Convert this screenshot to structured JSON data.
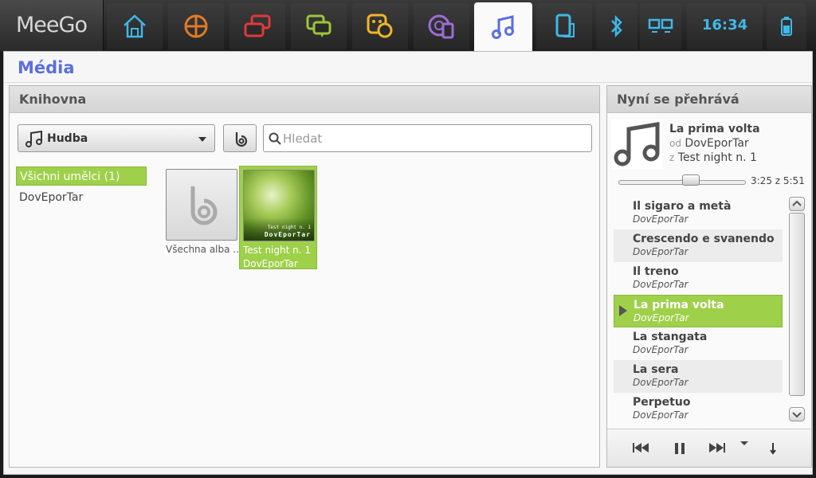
{
  "topbar": {
    "logo": "MeeGo",
    "tabs": [
      {
        "name": "home",
        "icon": "home-icon"
      },
      {
        "name": "apps",
        "icon": "apps-icon"
      },
      {
        "name": "zones",
        "icon": "zones-icon"
      },
      {
        "name": "status",
        "icon": "chat-icon"
      },
      {
        "name": "people",
        "icon": "people-icon"
      },
      {
        "name": "internet",
        "icon": "web-icon"
      },
      {
        "name": "media",
        "icon": "music-icon",
        "active": true
      },
      {
        "name": "devices",
        "icon": "devices-icon"
      }
    ],
    "clock": "16:34",
    "accent": "#3fb8e8"
  },
  "window": {
    "title": "Média"
  },
  "library": {
    "header": "Knihovna",
    "dropdown_value": "Hudba",
    "search_placeholder": "Hledat",
    "artists": [
      {
        "label": "Všichni umělci (1)",
        "selected": true
      },
      {
        "label": "DovEporTar",
        "selected": false
      }
    ],
    "albums": [
      {
        "title": "Všechna alba ...",
        "artist": "",
        "selected": false
      },
      {
        "title": "Test night n. 1",
        "artist": "DovEporTar",
        "selected": true,
        "cover_text_1": "Test night n. 1",
        "cover_text_2": "DovEporTar"
      }
    ]
  },
  "now_playing": {
    "header": "Nyní se přehrává",
    "title": "La prima volta",
    "by_label": "od",
    "artist": "DovEporTar",
    "from_label": "z",
    "album": "Test night n. 1",
    "time": "3:25 z 5:51",
    "progress": 0.58,
    "songs": [
      {
        "title": "Il sigaro a metà",
        "artist": "DovEporTar"
      },
      {
        "title": "Crescendo e svanendo",
        "artist": "DovEporTar"
      },
      {
        "title": "Il treno",
        "artist": "DovEporTar"
      },
      {
        "title": "La prima volta",
        "artist": "DovEporTar",
        "playing": true
      },
      {
        "title": "La stangata",
        "artist": "DovEporTar"
      },
      {
        "title": "La sera",
        "artist": "DovEporTar"
      },
      {
        "title": "Perpetuo",
        "artist": "DovEporTar"
      }
    ]
  },
  "colors": {
    "selection": "#9ed04a",
    "title": "#5b6ee0"
  }
}
